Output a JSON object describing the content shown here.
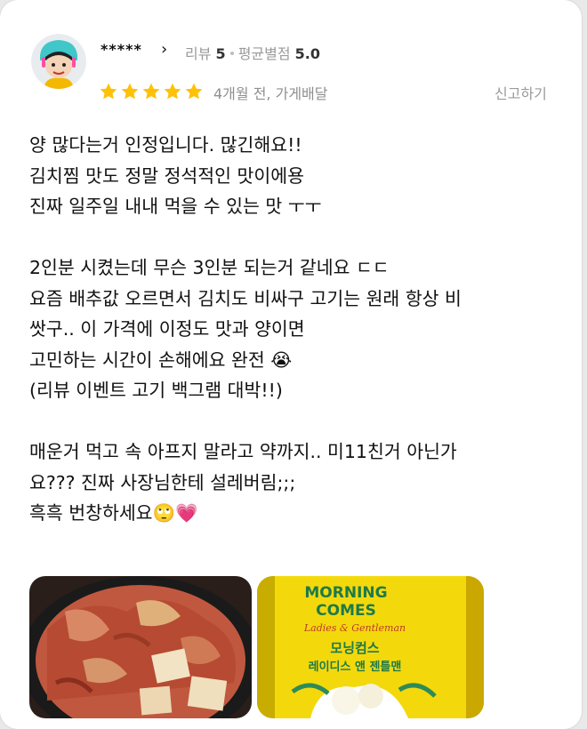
{
  "review": {
    "user": {
      "name": "*****",
      "chevron": "›",
      "review_label": "리뷰",
      "review_count": "5",
      "avg_label": "평균별점",
      "avg_rating": "5.0",
      "avatar_icon": "cartoon-avatar-icon"
    },
    "rating": 5,
    "date_source": "4개월 전, 가게배달",
    "report_label": "신고하기",
    "star_color": "#ffc107",
    "body_lines": [
      "양 많다는거 인정입니다. 많긴해요!!",
      "김치찜 맛도 정말 정석적인 맛이에용",
      "진짜 일주일 내내 먹을 수 있는 맛 ㅜㅜ",
      "",
      "2인분 시켰는데 무슨 3인분 되는거 같네요 ㄷㄷ",
      "요즘 배추값 오르면서 김치도 비싸구 고기는 원래 항상 비",
      "쌋구.. 이 가격에 이정도 맛과 양이면",
      "고민하는 시간이 손해에요 완전 😭",
      "(리뷰 이벤트 고기 백그램 대박!!)",
      "",
      "매운거 먹고 속 아프지 말라고 약까지.. 미11친거 아닌가",
      "요??? 진짜 사장님한테 설레버림;;;",
      "흑흑 번창하세요🙄💗"
    ],
    "photos": [
      {
        "name": "kimchi-jjim-photo"
      },
      {
        "name": "morning-comes-packet-photo",
        "brand_line1": "MORNING",
        "brand_line2": "COMES",
        "brand_sub": "Ladies & Gentleman",
        "brand_kr": "모닝컴스",
        "brand_kr2": "레이디스 앤 젠틀맨"
      }
    ]
  }
}
